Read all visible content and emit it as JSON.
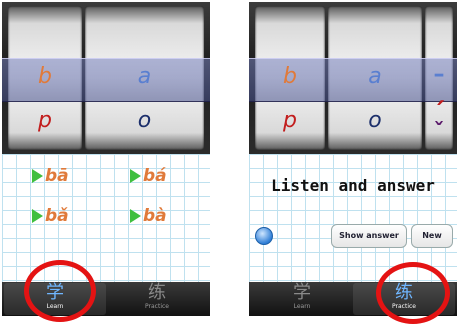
{
  "left_screen": {
    "picker": {
      "column1": {
        "selected": "b",
        "next": "p"
      },
      "column2": {
        "selected": "a",
        "next": "o"
      }
    },
    "syllables": [
      "bā",
      "bá",
      "bǎ",
      "bà"
    ],
    "tabs": [
      {
        "glyph": "学",
        "label": "Learn",
        "active": true
      },
      {
        "glyph": "练",
        "label": "Practice",
        "active": false
      }
    ]
  },
  "right_screen": {
    "picker": {
      "column1": {
        "selected": "b",
        "next": "p"
      },
      "column2": {
        "selected": "a",
        "next": "o"
      },
      "column3": {
        "selected": "–",
        "next": "ˊ",
        "below": "ˇ"
      }
    },
    "prompt": "Listen and answer",
    "buttons": {
      "show_answer": "Show answer",
      "new": "New"
    },
    "tabs": [
      {
        "glyph": "学",
        "label": "Learn",
        "active": false
      },
      {
        "glyph": "练",
        "label": "Practice",
        "active": true
      }
    ]
  },
  "colors": {
    "highlight_ring": "#e41313",
    "initial": "#e07a3a",
    "final": "#5a7fd0",
    "play": "#3fbf3f"
  }
}
